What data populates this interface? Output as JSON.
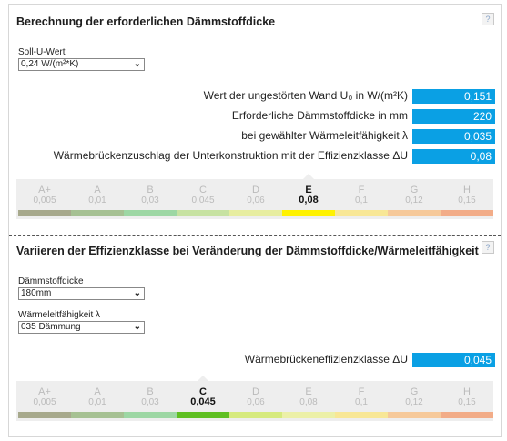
{
  "section1": {
    "title": "Berechnung der erforderlichen Dämmstoffdicke",
    "help": "?",
    "soll_u_label": "Soll-U-Wert",
    "soll_u_value": "0,24 W/(m²*K)",
    "rows": [
      {
        "label": "Wert der ungestörten Wand U₀ in W/(m²K)",
        "value": "0,151"
      },
      {
        "label": "Erforderliche Dämmstoffdicke in mm",
        "value": "220"
      },
      {
        "label": "bei gewählter Wärmeleitfähigkeit λ",
        "value": "0,035"
      },
      {
        "label": "Wärmebrückenzuschlag der Unterkonstruktion mit der Effizienzklasse ΔU",
        "value": "0,08"
      }
    ],
    "active_class": "E",
    "classes": [
      {
        "letter": "A+",
        "value": "0,005",
        "color": "#a7a98c"
      },
      {
        "letter": "A",
        "value": "0,01",
        "color": "#a6c193"
      },
      {
        "letter": "B",
        "value": "0,03",
        "color": "#9dd7a4"
      },
      {
        "letter": "C",
        "value": "0,045",
        "color": "#c7e2a2"
      },
      {
        "letter": "D",
        "value": "0,06",
        "color": "#e7eda0"
      },
      {
        "letter": "E",
        "value": "0,08",
        "color": "#fff200"
      },
      {
        "letter": "F",
        "value": "0,1",
        "color": "#f8e796"
      },
      {
        "letter": "G",
        "value": "0,12",
        "color": "#f6c99a"
      },
      {
        "letter": "H",
        "value": "0,15",
        "color": "#f2ac88"
      }
    ]
  },
  "section2": {
    "title": "Variieren der Effizienzklasse bei Veränderung der Dämmstoffdicke/Wärmeleitfähigkeit",
    "help": "?",
    "thickness_label": "Dämmstoffdicke",
    "thickness_value": "180mm",
    "conductivity_label": "Wärmeleitfähigkeit λ",
    "conductivity_value": "035 Dämmung",
    "result_label": "Wärmebrückeneffizienzklasse ΔU",
    "result_value": "0,045",
    "active_class": "C",
    "classes": [
      {
        "letter": "A+",
        "value": "0,005",
        "color": "#a7a98c"
      },
      {
        "letter": "A",
        "value": "0,01",
        "color": "#a6c193"
      },
      {
        "letter": "B",
        "value": "0,03",
        "color": "#9dd7a4"
      },
      {
        "letter": "C",
        "value": "0,045",
        "color": "#5fbf22"
      },
      {
        "letter": "D",
        "value": "0,06",
        "color": "#d6ea7e"
      },
      {
        "letter": "E",
        "value": "0,08",
        "color": "#ecf0a8"
      },
      {
        "letter": "F",
        "value": "0,1",
        "color": "#f8e796"
      },
      {
        "letter": "G",
        "value": "0,12",
        "color": "#f6c99a"
      },
      {
        "letter": "H",
        "value": "0,15",
        "color": "#f2ac88"
      }
    ]
  }
}
